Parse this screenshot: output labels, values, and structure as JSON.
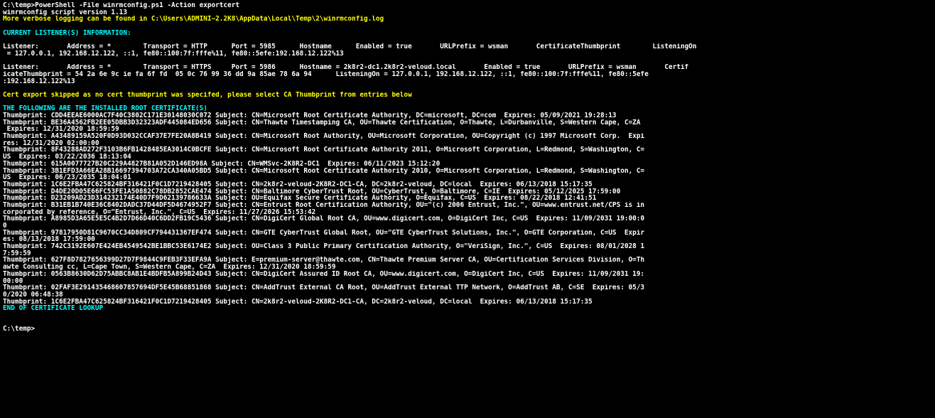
{
  "colors": {
    "background": "#000000",
    "default_text": "#ffffff",
    "warning_text": "#ffff00",
    "section_text": "#00ffff"
  },
  "terminal": {
    "header": [
      "C:\\temp>PowerShell -File winrmconfig.ps1 -Action exportcert",
      "winrmconfig script version 1.13",
      "More verbose logging can be found in C:\\Users\\ADMINI~2.2K8\\AppData\\Local\\Temp\\2\\winrmconfig.log"
    ],
    "listener_heading": "CURRENT LISTENER(S) INFORMATION:",
    "listener1": [
      "Listener:       Address = *        Transport = HTTP      Port = 5985      Hostname      Enabled = true       URLPrefix = wsman       CertificateThumbprint        ListeningOn",
      " = 127.0.0.1, 192.168.12.122, ::1, fe80::100:7f:fffe%11, fe80::5efe:192.168.12.122%13"
    ],
    "listener2": [
      "Listener:       Address = *        Transport = HTTPS     Port = 5986      Hostname = 2k8r2-dc1.2k8r2-veloud.local       Enabled = true       URLPrefix = wsman       Certif",
      "icateThumbprint = 54 2a 6e 9c ie fa 6f fd  05 0c 76 99 36 dd 9a 85ae 78 6a 94      ListeningOn = 127.0.0.1, 192.168.12.122, ::1, fe80::100:7f:fffe%11, fe80::5efe",
      ":192.168.12.122%13"
    ],
    "warning": "Cert export skipped as no cert thumbprint was specifed, please select CA Thumbprint from entries below",
    "certs_heading": "THE FOLLOWING ARE THE INSTALLED ROOT CERTIFICATE(S)",
    "certs": [
      "Thumbprint: CDD4EEAE6000AC7F40C3802C171E30148030C072 Subject: CN=Microsoft Root Certificate Authority, DC=microsoft, DC=com  Expires: 05/09/2021 19:28:13",
      "Thumbprint: BE36A4562FB2EE05DBB3D32323ADF445084ED656 Subject: CN=Thawte Timestamping CA, OU=Thawte Certification, O=Thawte, L=Durbanville, S=Western Cape, C=ZA",
      " Expires: 12/31/2020 18:59:59",
      "Thumbprint: A43489159A520F0D93D032CCAF37E7FE20A8B419 Subject: CN=Microsoft Root Authority, OU=Microsoft Corporation, OU=Copyright (c) 1997 Microsoft Corp.  Expi",
      "res: 12/31/2020 02:00:00",
      "Thumbprint: 8F43288AD272F3103B6FB1428485EA3014C0BCFE Subject: CN=Microsoft Root Certificate Authority 2011, O=Microsoft Corporation, L=Redmond, S=Washington, C=",
      "US  Expires: 03/22/2036 18:13:04",
      "Thumbprint: 615A0077727B20C229A4827B81A052D146ED98A Subject: CN=WMSvc-2K8R2-DC1  Expires: 06/11/2023 15:12:20",
      "Thumbprint: 3B1EFD3A66EA28B16697394703A72CA340A05BD5 Subject: CN=Microsoft Root Certificate Authority 2010, O=Microsoft Corporation, L=Redmond, S=Washington, C=",
      "US  Expires: 06/23/2035 18:04:01",
      "Thumbprint: 1C6E2FBA47C625824BF316421F0C1D7219428405 Subject: CN=2k8r2-veloud-2K8R2-DC1-CA, DC=2k8r2-veloud, DC=local  Expires: 06/13/2018 15:17:35",
      "Thumbprint: D4DE20D05E66FC53FE1A50882C78DB2852CAE474 Subject: CN=Baltimore CyberTrust Root, OU=CyberTrust, O=Baltimore, C=IE  Expires: 05/12/2025 17:59:00",
      "Thumbprint: D23209AD23D314232174E40D7F9D62139786633A Subject: OU=Equifax Secure Certificate Authority, O=Equifax, C=US  Expires: 08/22/2018 12:41:51",
      "Thumbprint: B31EB1B740E36C8402DADC37D44DF5D4674952F7 Subject: CN=Entrust Root Certification Authority, OU=\"(c) 2006 Entrust, Inc.\", OU=www.entrust.net/CPS is in",
      "corporated by reference, O=\"Entrust, Inc.\", C=US  Expires: 11/27/2026 15:53:42",
      "Thumbprint: A8985D3A65E5E5C4B2D7D66D40C6DD2FB19C5436 Subject: CN=DigiCert Global Root CA, OU=www.digicert.com, O=DigiCert Inc, C=US  Expires: 11/09/2031 19:00:0",
      "0",
      "Thumbprint: 97817950D81C9670CC34D809CF794431367EF474 Subject: CN=GTE CyberTrust Global Root, OU=\"GTE CyberTrust Solutions, Inc.\", O=GTE Corporation, C=US  Expir",
      "es: 08/13/2018 17:59:00",
      "Thumbprint: 742C3192E607E424EB4549542BE1BBC53E6174E2 Subject: OU=Class 3 Public Primary Certification Authority, O=\"VeriSign, Inc.\", C=US  Expires: 08/01/2028 1",
      "7:59:59",
      "Thumbprint: 627F8D7827656399D27D7F9844C9FEB3F33EFA9A Subject: E=premium-server@thawte.com, CN=Thawte Premium Server CA, OU=Certification Services Division, O=Th",
      "awte Consulting cc, L=Cape Town, S=Western Cape, C=ZA  Expires: 12/31/2020 18:59:59",
      "Thumbprint: 0563B8630D62D75ABBC8AB1E4BDFB5A899B24D43 Subject: CN=DigiCert Assured ID Root CA, OU=www.digicert.com, O=DigiCert Inc, C=US  Expires: 11/09/2031 19:",
      "00:00",
      "Thumbprint: 02FAF3E291435468607857694DF5E45B68851868 Subject: CN=AddTrust External CA Root, OU=AddTrust External TTP Network, O=AddTrust AB, C=SE  Expires: 05/3",
      "0/2020 06:48:38",
      "Thumbprint: 1C6E2FBA47C625824BF316421F0C1D7219428405 Subject: CN=2k8r2-veloud-2K8R2-DC1-CA, DC=2k8r2-veloud, DC=local  Expires: 06/13/2018 15:17:35"
    ],
    "end_line": "END OF CERTIFICATE LOOKUP",
    "prompt": "C:\\temp>"
  }
}
